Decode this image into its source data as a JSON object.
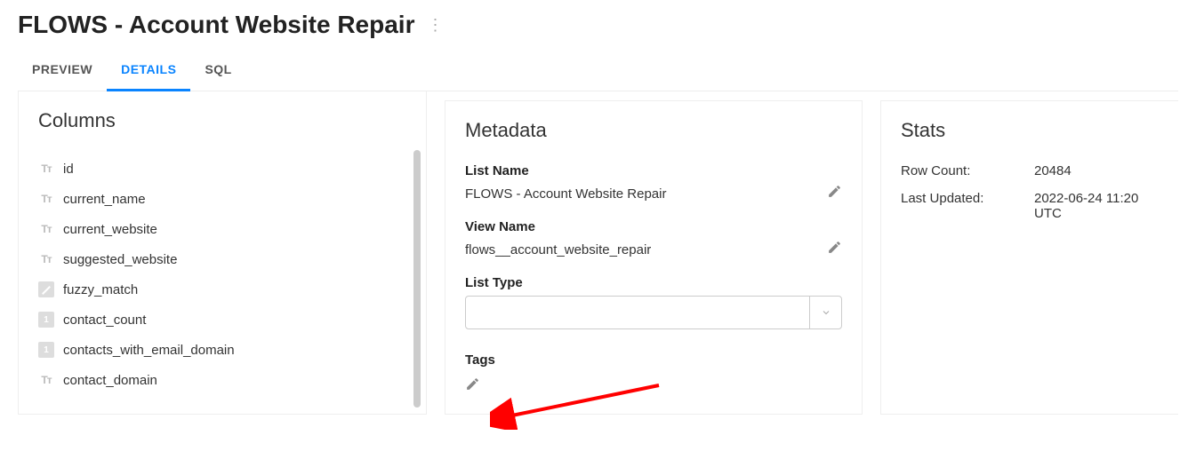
{
  "header": {
    "title": "FLOWS - Account Website Repair"
  },
  "tabs": [
    {
      "label": "PREVIEW",
      "active": false
    },
    {
      "label": "DETAILS",
      "active": true
    },
    {
      "label": "SQL",
      "active": false
    }
  ],
  "columns": {
    "heading": "Columns",
    "items": [
      {
        "name": "id",
        "type": "text"
      },
      {
        "name": "current_name",
        "type": "text"
      },
      {
        "name": "current_website",
        "type": "text"
      },
      {
        "name": "suggested_website",
        "type": "text"
      },
      {
        "name": "fuzzy_match",
        "type": "fuzzy"
      },
      {
        "name": "contact_count",
        "type": "number"
      },
      {
        "name": "contacts_with_email_domain",
        "type": "number"
      },
      {
        "name": "contact_domain",
        "type": "text"
      }
    ]
  },
  "metadata": {
    "heading": "Metadata",
    "list_name_label": "List Name",
    "list_name_value": "FLOWS - Account Website Repair",
    "view_name_label": "View Name",
    "view_name_value": "flows__account_website_repair",
    "list_type_label": "List Type",
    "list_type_value": "",
    "tags_label": "Tags"
  },
  "stats": {
    "heading": "Stats",
    "row_count_label": "Row Count:",
    "row_count_value": "20484",
    "last_updated_label": "Last Updated:",
    "last_updated_value": "2022-06-24 11:20 UTC"
  }
}
